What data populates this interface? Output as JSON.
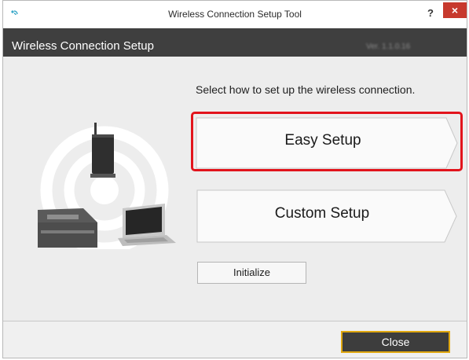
{
  "window": {
    "title": "Wireless Connection Setup Tool",
    "help_label": "?",
    "close_label": "×"
  },
  "header": {
    "title": "Wireless Connection Setup",
    "version": "Ver. 1.1.0.16"
  },
  "main": {
    "instruction": "Select how to set up the wireless connection.",
    "easy_setup_label": "Easy Setup",
    "custom_setup_label": "Custom Setup",
    "initialize_label": "Initialize"
  },
  "footer": {
    "close_label": "Close"
  },
  "colors": {
    "header_bg": "#3f3f3f",
    "highlight": "#e2141c",
    "close_border": "#e0a70f"
  }
}
